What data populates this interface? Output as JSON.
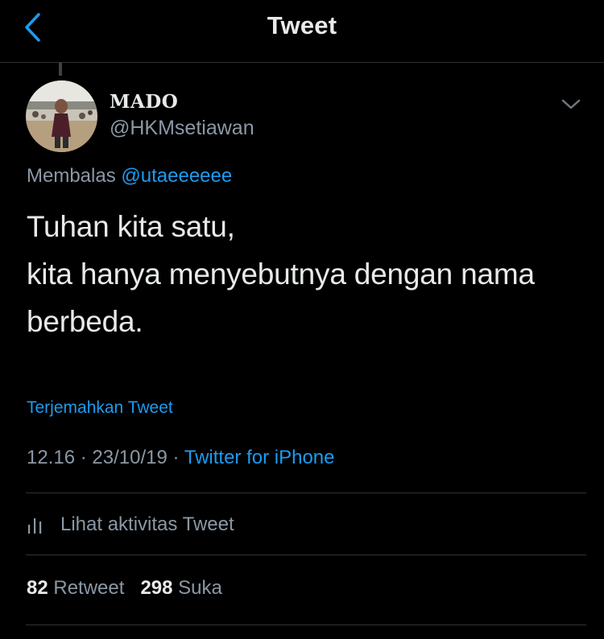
{
  "header": {
    "title": "Tweet",
    "back_icon": "chevron-left-icon"
  },
  "tweet": {
    "author": {
      "display_name": "MADO",
      "handle": "@HKMsetiawan"
    },
    "reply_prefix": "Membalas",
    "reply_to": "@utaeeeeee",
    "text": "Tuhan kita satu,\nkita hanya menyebutnya dengan nama berbeda.",
    "translate_label": "Terjemahkan Tweet",
    "time": "12.16",
    "date": "23/10/19",
    "separator": "·",
    "source": "Twitter for iPhone",
    "activity_label": "Lihat aktivitas Tweet",
    "activity_icon": "bar-chart-icon",
    "more_icon": "chevron-down-icon",
    "retweets": {
      "count": "82",
      "label": "Retweet"
    },
    "likes": {
      "count": "298",
      "label": "Suka"
    }
  },
  "colors": {
    "background": "#000000",
    "accent": "#1d9bf0",
    "secondary_text": "#8b98a5",
    "primary_text": "#e7e9ea",
    "divider": "#2f3336"
  }
}
